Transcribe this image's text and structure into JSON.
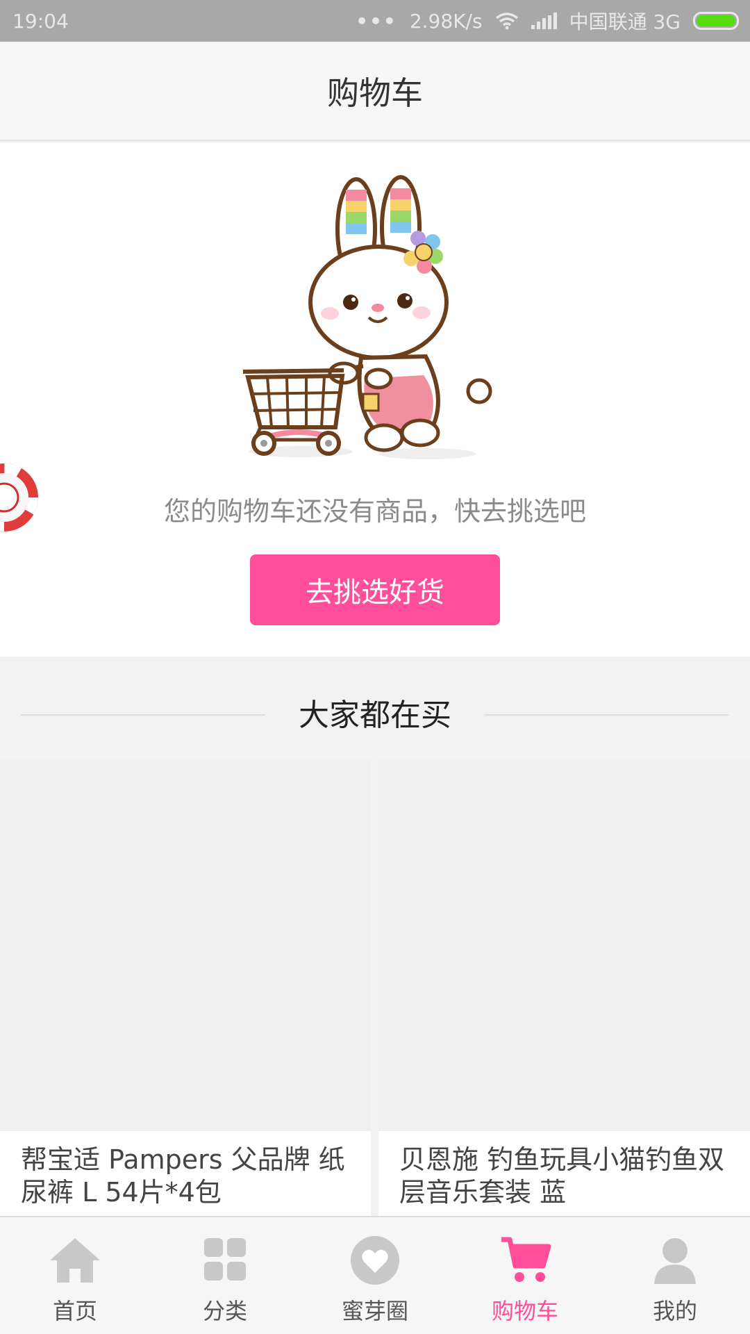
{
  "status_bar": {
    "time": "19:04",
    "net_speed": "2.98K/s",
    "carrier": "中国联通 3G",
    "icons": [
      "dots-icon",
      "wifi-icon",
      "signal-icon",
      "battery-icon"
    ]
  },
  "header": {
    "title": "购物车"
  },
  "empty_cart": {
    "illustration": "bunny-cart-illustration",
    "message": "您的购物车还没有商品，快去挑选吧",
    "button_label": "去挑选好货"
  },
  "recommend": {
    "title": "大家都在买",
    "products": [
      {
        "name": "帮宝适 Pampers 父品牌 纸尿裤 L 54片*4包"
      },
      {
        "name": "贝恩施 钓鱼玩具小猫钓鱼双层音乐套装 蓝"
      }
    ]
  },
  "tabs": [
    {
      "label": "首页",
      "icon": "home-icon"
    },
    {
      "label": "分类",
      "icon": "grid-icon"
    },
    {
      "label": "蜜芽圈",
      "icon": "heart-icon"
    },
    {
      "label": "购物车",
      "icon": "cart-icon",
      "active": true
    },
    {
      "label": "我的",
      "icon": "user-icon"
    }
  ],
  "colors": {
    "accent": "#ff4f9a",
    "inactive_icon": "#c8c8c8"
  }
}
